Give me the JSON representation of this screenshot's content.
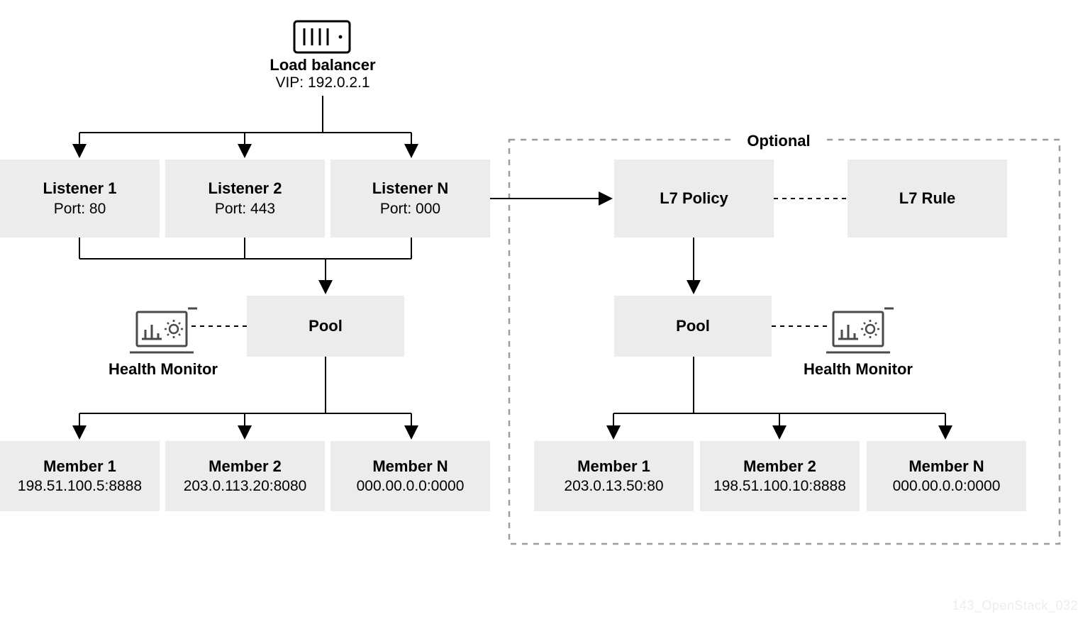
{
  "loadBalancer": {
    "title": "Load balancer",
    "sub": "VIP: 192.0.2.1"
  },
  "listeners": [
    {
      "title": "Listener 1",
      "sub": "Port: 80"
    },
    {
      "title": "Listener 2",
      "sub": "Port: 443"
    },
    {
      "title": "Listener N",
      "sub": "Port: 000"
    }
  ],
  "poolLeft": {
    "title": "Pool"
  },
  "healthMonitorLeft": {
    "label": "Health Monitor"
  },
  "membersLeft": [
    {
      "title": "Member 1",
      "sub": "198.51.100.5:8888"
    },
    {
      "title": "Member 2",
      "sub": "203.0.113.20:8080"
    },
    {
      "title": "Member N",
      "sub": "000.00.0.0:0000"
    }
  ],
  "optional": {
    "label": "Optional"
  },
  "l7policy": {
    "title": "L7 Policy"
  },
  "l7rule": {
    "title": "L7 Rule"
  },
  "poolRight": {
    "title": "Pool"
  },
  "healthMonitorRight": {
    "label": "Health Monitor"
  },
  "membersRight": [
    {
      "title": "Member 1",
      "sub": "203.0.13.50:80"
    },
    {
      "title": "Member 2",
      "sub": "198.51.100.10:8888"
    },
    {
      "title": "Member N",
      "sub": "000.00.0.0:0000"
    }
  ],
  "watermark": "143_OpenStack_032"
}
